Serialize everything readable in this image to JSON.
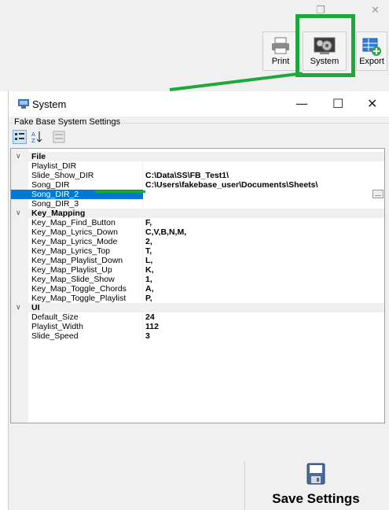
{
  "app_toolbar": {
    "buttons": [
      {
        "label": "Print",
        "icon": "printer-icon"
      },
      {
        "label": "System",
        "icon": "system-settings-icon"
      },
      {
        "label": "Export",
        "icon": "export-icon"
      }
    ]
  },
  "window": {
    "title": "System",
    "min_glyph": "—",
    "max_glyph": "☐",
    "close_glyph": "✕"
  },
  "settings_group": {
    "label": "Fake Base System Settings"
  },
  "property_grid": {
    "categories": [
      {
        "name": "File",
        "properties": [
          {
            "name": "Playlist_DIR",
            "value": ""
          },
          {
            "name": "Slide_Show_DIR",
            "value": "C:\\Data\\SS\\FB_Test1\\"
          },
          {
            "name": "Song_DIR",
            "value": "C:\\Users\\fakebase_user\\Documents\\Sheets\\"
          },
          {
            "name": "Song_DIR_2",
            "value": ""
          },
          {
            "name": "Song_DIR_3",
            "value": ""
          }
        ]
      },
      {
        "name": "Key_Mapping",
        "properties": [
          {
            "name": "Key_Map_Find_Button",
            "value": "F,"
          },
          {
            "name": "Key_Map_Lyrics_Down",
            "value": "C,V,B,N,M,"
          },
          {
            "name": "Key_Map_Lyrics_Mode",
            "value": "2,"
          },
          {
            "name": "Key_Map_Lyrics_Top",
            "value": "T,"
          },
          {
            "name": "Key_Map_Playlist_Down",
            "value": "L,"
          },
          {
            "name": "Key_Map_Playlist_Up",
            "value": "K,"
          },
          {
            "name": "Key_Map_Slide_Show",
            "value": "1,"
          },
          {
            "name": "Key_Map_Toggle_Chords",
            "value": "A,"
          },
          {
            "name": "Key_Map_Toggle_Playlist",
            "value": "P,"
          }
        ]
      },
      {
        "name": "UI",
        "properties": [
          {
            "name": "Default_Size",
            "value": "24"
          },
          {
            "name": "Playlist_Width",
            "value": "112"
          },
          {
            "name": "Slide_Speed",
            "value": "3"
          }
        ]
      }
    ],
    "selected_property": "Song_DIR_2",
    "ellipsis_label": "..."
  },
  "save_button": {
    "label": "Save Settings",
    "icon": "floppy-disk-icon"
  },
  "colors": {
    "highlight_green": "#1ea73c",
    "selection_blue": "#0078d7"
  }
}
